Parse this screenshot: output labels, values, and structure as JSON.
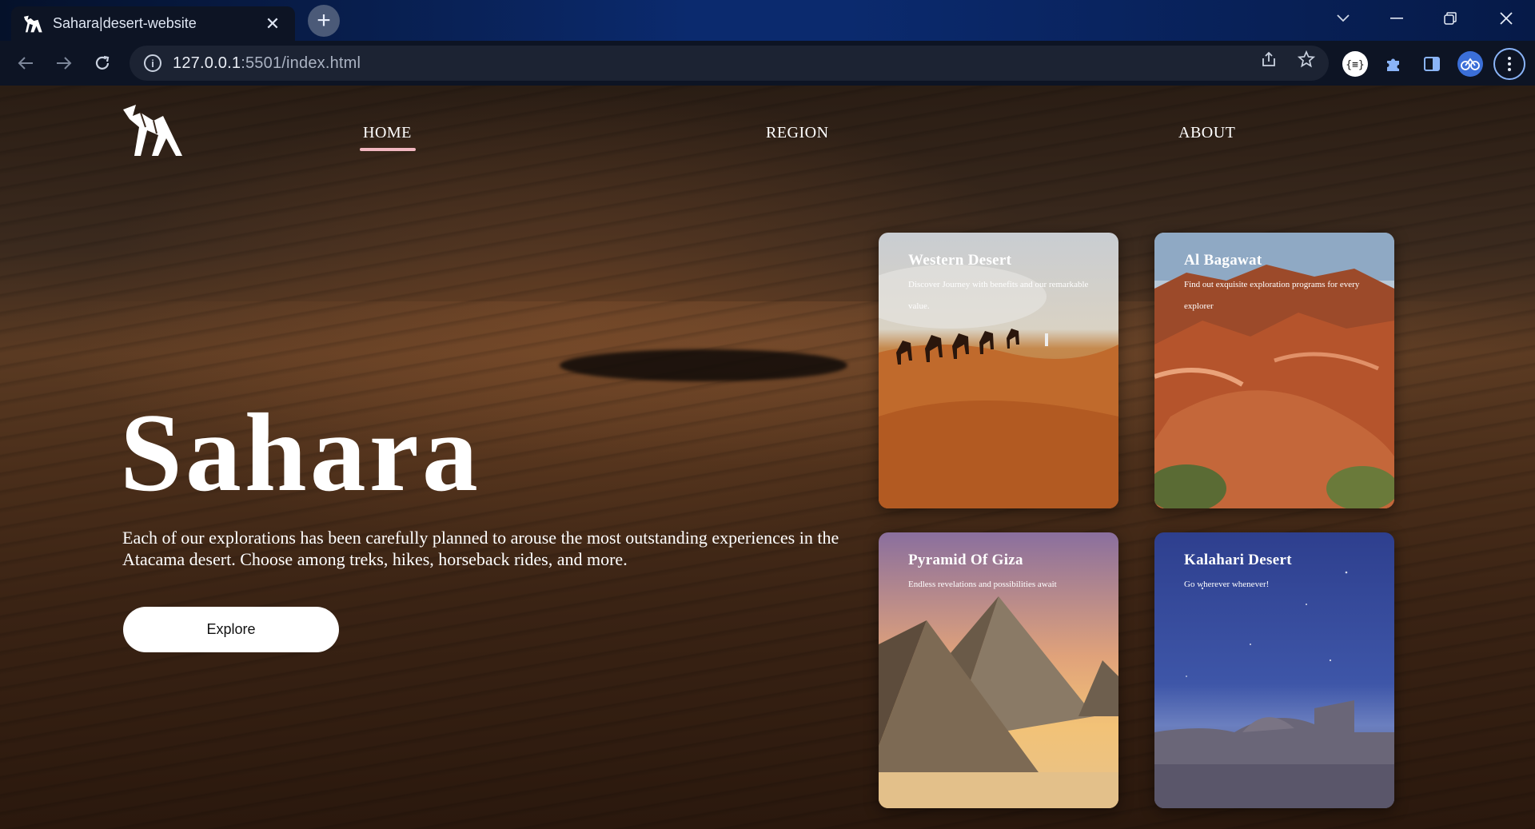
{
  "browser": {
    "tab_title": "Sahara|desert-website",
    "url_host": "127.0.0.1",
    "url_rest": ":5501/index.html",
    "new_tab": "+",
    "close_tab": "✕"
  },
  "site": {
    "nav": [
      {
        "label": "HOME",
        "active": true
      },
      {
        "label": "REGION",
        "active": false
      },
      {
        "label": "ABOUT",
        "active": false
      }
    ],
    "hero": {
      "title": "Sahara",
      "text": "Each of our explorations has been carefully planned to arouse the most outstanding experiences in the Atacama desert. Choose among treks, hikes, horseback rides, and more.",
      "button": "Explore"
    },
    "cards": [
      {
        "title": "Western Desert",
        "subtitle": "Discover Journey with benefits and our remarkable value."
      },
      {
        "title": "Al Bagawat",
        "subtitle": "Find out exquisite exploration programs for every explorer"
      },
      {
        "title": "Pyramid Of Giza",
        "subtitle": "Endless revelations and possibilities await"
      },
      {
        "title": "Kalahari Desert",
        "subtitle": "Go wherever whenever!"
      }
    ],
    "colors": {
      "nav_underline": "#f1b7c0",
      "button_bg": "#ffffff"
    }
  }
}
